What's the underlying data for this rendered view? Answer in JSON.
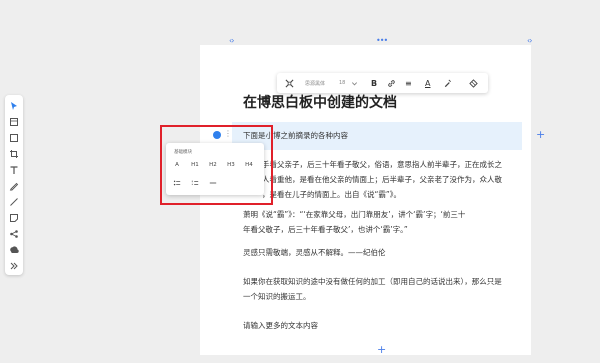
{
  "canvas": {
    "top_dots": "•••",
    "left_handle": "‹›",
    "right_handle": "‹›"
  },
  "left_toolbar": {
    "tools": [
      {
        "name": "select-tool",
        "icon": "cursor-icon"
      },
      {
        "name": "frame-tool",
        "icon": "frame-icon"
      },
      {
        "name": "shape-tool",
        "icon": "square-icon"
      },
      {
        "name": "crop-tool",
        "icon": "crop-icon"
      },
      {
        "name": "text-tool",
        "icon": "text-icon"
      },
      {
        "name": "pen-tool",
        "icon": "pen-icon"
      },
      {
        "name": "line-tool",
        "icon": "line-icon"
      },
      {
        "name": "sticky-tool",
        "icon": "sticky-note-icon"
      },
      {
        "name": "mindmap-tool",
        "icon": "mindmap-icon"
      },
      {
        "name": "upload-tool",
        "icon": "upload-icon"
      },
      {
        "name": "more-tool",
        "icon": "double-chevron-icon"
      }
    ],
    "accent": "#2f80ed"
  },
  "format_toolbar": {
    "font_family": "思源黑体",
    "font_size": "18",
    "bold": "B",
    "align": "≡",
    "highlight": "A"
  },
  "document": {
    "title": "在博思白板中创建的文档",
    "highlighted_paragraph": "下面是小博之前摘录的各种内容",
    "paragraph_1_lines": [
      "手看父亲子，后三十年看子敬父，俗语，意思指人前半辈子，正在成长之",
      "人看重他，是看在他父亲的情面上；后半辈子，父亲老了没作为，众人敬",
      "，是看在儿子的情面上。出自《说“霸”》。"
    ],
    "paragraph_2_lines": [
      "萧明《说“霸”》：“‘在家靠父母，出门靠朋友’，讲个‘霸’字；‘前三十",
      "年看父敬子，后三十年看子敬父’，也讲个‘霸’字。”"
    ],
    "paragraph_3": "灵感只需敬端，灵感从不解释。——纪伯伦",
    "paragraph_4_lines": [
      "如果你在获取知识的途中没有做任何的加工（即用自己的话说出来），那么只是",
      "一个知识的搬运工。"
    ],
    "paragraph_5": "请输入更多的文本内容"
  },
  "heading_menu": {
    "title": "基础模块",
    "row1": [
      "A",
      "H1",
      "H2",
      "H3",
      "H4"
    ],
    "row2_icons": [
      "bullet-list-icon",
      "numbered-list-icon",
      "divider-icon"
    ],
    "highlight_color": "#e0202a"
  }
}
